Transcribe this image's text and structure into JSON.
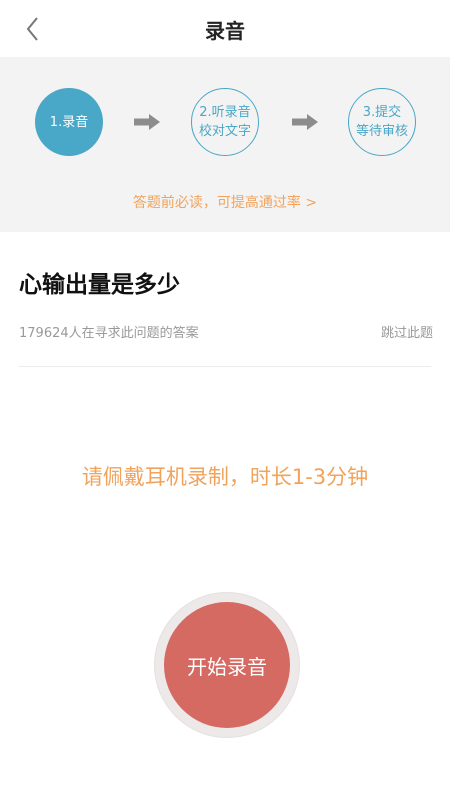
{
  "header": {
    "title": "录音",
    "back_icon": "chevron-left-icon"
  },
  "steps": [
    {
      "label": "1.录音",
      "state": "active"
    },
    {
      "label": "2.听录音\n校对文字",
      "state": "inactive"
    },
    {
      "label": "3.提交\n等待审核",
      "state": "inactive"
    }
  ],
  "arrow_icon": "arrow-right-icon",
  "tips_link": "答题前必读，可提高通过率 >",
  "question": {
    "title": "心输出量是多少",
    "seek_count": "179624人在寻求此问题的答案",
    "skip_label": "跳过此题"
  },
  "instruction": "请佩戴耳机录制，时长1-3分钟",
  "record_button": "开始录音",
  "colors": {
    "accent_blue": "#49a7c7",
    "accent_orange": "#f1a35c",
    "record_red": "#d56a63"
  }
}
